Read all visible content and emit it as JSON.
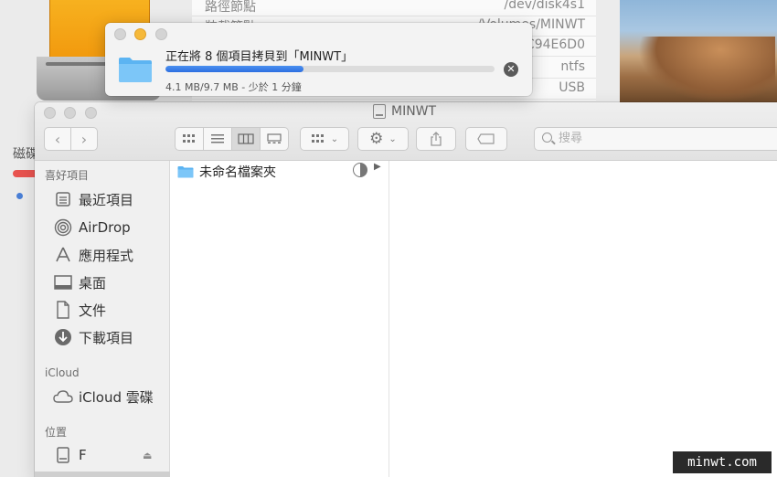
{
  "background": {
    "info_rows": [
      {
        "key": "路徑節點",
        "value": "/dev/disk4s1"
      },
      {
        "key": "裝載節點",
        "value": "/Volumes/MINWT"
      },
      {
        "key": "",
        "value": "C94E6D0"
      },
      {
        "key": "",
        "value": "ntfs"
      },
      {
        "key": "",
        "value": "USB"
      }
    ],
    "sidebar_text": "磁碟"
  },
  "copy_dialog": {
    "title": "正在將 8 個項目拷貝到「MINWT」",
    "status": "4.1 MB/9.7 MB - 少於 1 分鐘",
    "progress": 0.42,
    "progress_color": "#2d6fe0"
  },
  "finder": {
    "window_title": "MINWT",
    "search_placeholder": "搜尋",
    "sidebar": {
      "favorites_header": "喜好項目",
      "favorites": [
        {
          "label": "最近項目",
          "icon": "recents-icon"
        },
        {
          "label": "AirDrop",
          "icon": "airdrop-icon"
        },
        {
          "label": "應用程式",
          "icon": "applications-icon"
        },
        {
          "label": "桌面",
          "icon": "desktop-icon"
        },
        {
          "label": "文件",
          "icon": "documents-icon"
        },
        {
          "label": "下載項目",
          "icon": "downloads-icon"
        }
      ],
      "icloud_header": "iCloud",
      "icloud": [
        {
          "label": "iCloud 雲碟",
          "icon": "cloud-icon"
        }
      ],
      "locations_header": "位置",
      "locations": [
        {
          "label": "F",
          "icon": "drive-icon"
        }
      ]
    },
    "column1": [
      {
        "name": "未命名檔案夾"
      }
    ]
  },
  "watermark": "minwt.com"
}
